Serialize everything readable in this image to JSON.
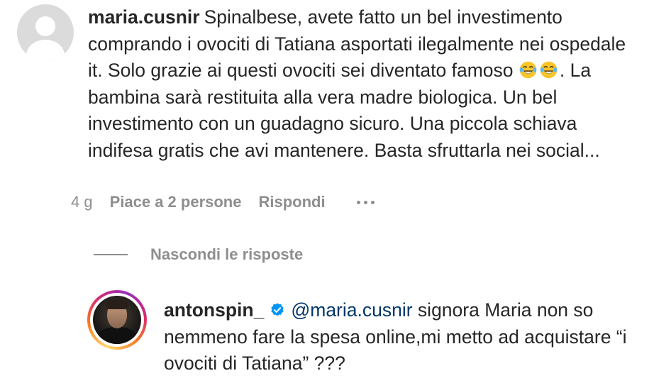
{
  "comment": {
    "username": "maria.cusnir",
    "text_part1": "Spinalbese, avete fatto un bel investimento comprando i ovociti di Tatiana asportati ilegalmente nei ospedale it. Solo grazie ai questi ovociti sei diventato famoso ",
    "emojis": [
      "face-with-tears-of-joy",
      "face-with-tears-of-joy"
    ],
    "text_part2": ". La bambina sarà restituita alla vera madre biologica. Un bel investimento con un guadagno sicuro. Una piccola schiava indifesa gratis che avi mantenere. Basta sfruttarla nei social...",
    "time": "4 g",
    "likes": "Piace a 2 persone",
    "reply_label": "Rispondi"
  },
  "replies_toggle": {
    "label": "Nascondi le risposte"
  },
  "reply": {
    "username": "antonspin_",
    "verified_icon": "verified-badge-icon",
    "mention": "@maria.cusnir",
    "text": " signora Maria non so nemmeno fare la spesa online,mi metto ad acquistare “i ovociti di Tatiana” ???"
  },
  "colors": {
    "text": "#262626",
    "secondary": "#8e8e8e",
    "mention": "#00376b",
    "verified": "#0095f6",
    "avatar_placeholder": "#dbdbdb"
  }
}
